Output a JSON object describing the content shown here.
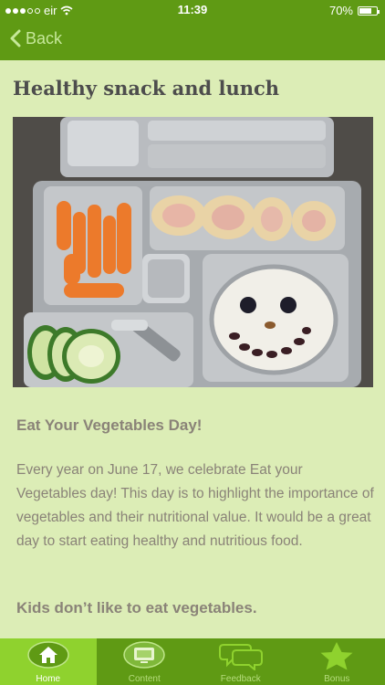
{
  "status_bar": {
    "carrier": "eir",
    "time": "11:39",
    "battery": "70%",
    "battery_level": 0.7
  },
  "nav": {
    "back_label": "Back"
  },
  "page": {
    "title": "Healthy snack and lunch",
    "photo_description_icon": "lunchbox-photo",
    "section_heading": "Eat Your Vegetables Day!",
    "body": "Every year on June 17, we celebrate Eat your Vegetables day! This day is to highlight the importance of vegetables and their nutritional value. It would be a great day to start eating healthy and nutritious food.",
    "section_heading_2": "Kids don’t like to eat vegetables."
  },
  "tabs": [
    {
      "label": "Home",
      "icon": "home-icon",
      "active": true
    },
    {
      "label": "Content",
      "icon": "monitor-icon",
      "active": false
    },
    {
      "label": "Feedback",
      "icon": "chat-bubbles-icon",
      "active": false
    },
    {
      "label": "Bonus",
      "icon": "star-icon",
      "active": false
    }
  ],
  "colors": {
    "bar_green": "#5f9a14",
    "active_tab": "#8fd22e",
    "background": "#dcedb6",
    "text_gray": "#8a8378"
  }
}
